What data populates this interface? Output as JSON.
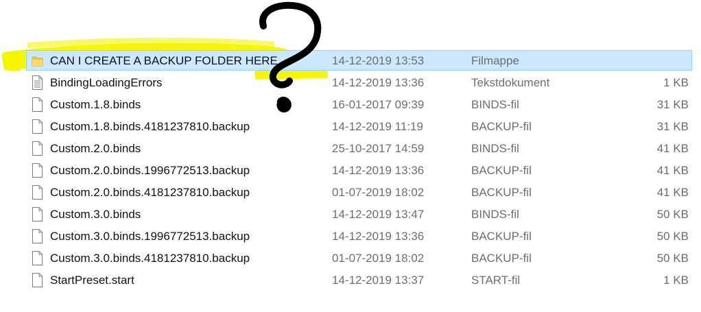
{
  "files": [
    {
      "name": "CAN I CREATE A BACKUP FOLDER HERE",
      "date": "14-12-2019 13:53",
      "type": "Filmappe",
      "size": "",
      "icon": "folder-icon",
      "selected": true
    },
    {
      "name": "BindingLoadingErrors",
      "date": "14-12-2019 13:36",
      "type": "Tekstdokument",
      "size": "1 KB",
      "icon": "text-file-icon"
    },
    {
      "name": "Custom.1.8.binds",
      "date": "16-01-2017 09:39",
      "type": "BINDS-fil",
      "size": "31 KB",
      "icon": "file-icon"
    },
    {
      "name": "Custom.1.8.binds.4181237810.backup",
      "date": "14-12-2019 11:19",
      "type": "BACKUP-fil",
      "size": "31 KB",
      "icon": "file-icon"
    },
    {
      "name": "Custom.2.0.binds",
      "date": "25-10-2017 14:59",
      "type": "BINDS-fil",
      "size": "41 KB",
      "icon": "file-icon"
    },
    {
      "name": "Custom.2.0.binds.1996772513.backup",
      "date": "14-12-2019 13:36",
      "type": "BACKUP-fil",
      "size": "41 KB",
      "icon": "file-icon"
    },
    {
      "name": "Custom.2.0.binds.4181237810.backup",
      "date": "01-07-2019 18:02",
      "type": "BACKUP-fil",
      "size": "41 KB",
      "icon": "file-icon"
    },
    {
      "name": "Custom.3.0.binds",
      "date": "14-12-2019 13:47",
      "type": "BINDS-fil",
      "size": "50 KB",
      "icon": "file-icon"
    },
    {
      "name": "Custom.3.0.binds.1996772513.backup",
      "date": "14-12-2019 13:36",
      "type": "BACKUP-fil",
      "size": "50 KB",
      "icon": "file-icon"
    },
    {
      "name": "Custom.3.0.binds.4181237810.backup",
      "date": "01-07-2019 18:02",
      "type": "BACKUP-fil",
      "size": "50 KB",
      "icon": "file-icon"
    },
    {
      "name": "StartPreset.start",
      "date": "14-12-2019 13:37",
      "type": "START-fil",
      "size": "1 KB",
      "icon": "file-icon"
    }
  ],
  "colors": {
    "selection_bg": "#cce8ff",
    "selection_border": "#99d1ff",
    "highlighter": "#f5f500",
    "folder": "#f4c542",
    "annotation_ink": "#000000"
  }
}
